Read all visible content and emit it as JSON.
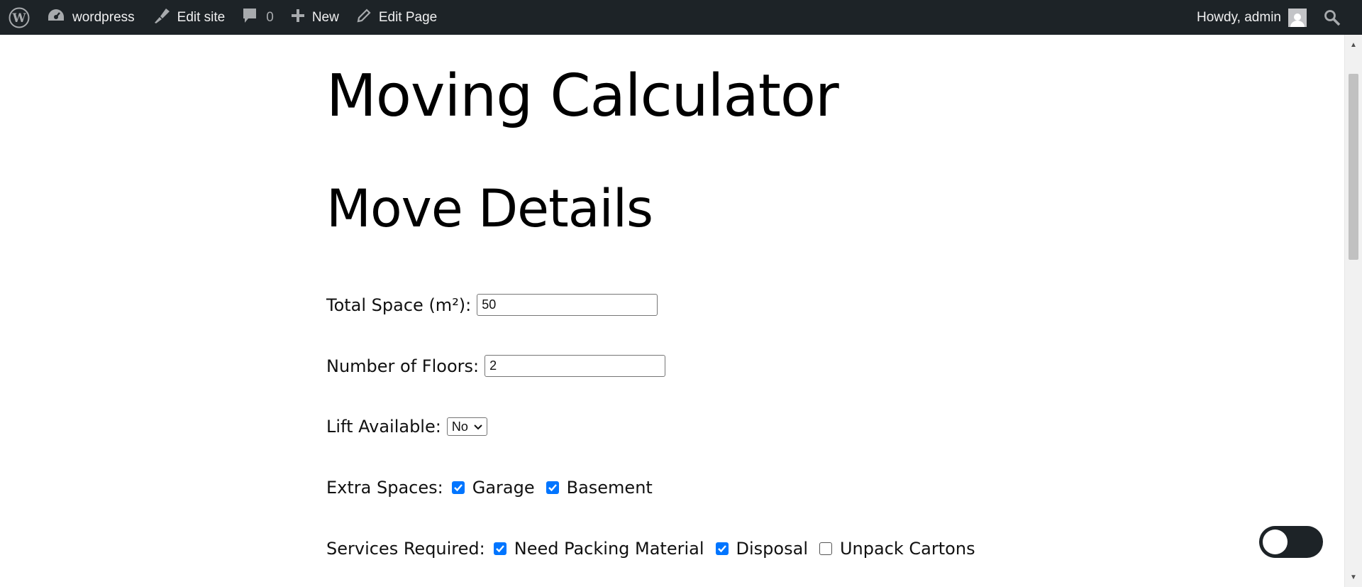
{
  "adminbar": {
    "site_name": "wordpress",
    "edit_site": "Edit site",
    "comments_count": "0",
    "new_label": "New",
    "edit_page": "Edit Page",
    "howdy": "Howdy, admin"
  },
  "page": {
    "title": "Moving Calculator",
    "section_title": "Move Details"
  },
  "form": {
    "total_space": {
      "label": "Total Space (m²):",
      "value": "50"
    },
    "floors": {
      "label": "Number of Floors:",
      "value": "2"
    },
    "lift": {
      "label": "Lift Available:",
      "selected": "No"
    },
    "extra_spaces": {
      "label": "Extra Spaces:",
      "options": [
        {
          "label": "Garage",
          "checked": true
        },
        {
          "label": "Basement",
          "checked": true
        }
      ]
    },
    "services": {
      "label": "Services Required:",
      "options": [
        {
          "label": "Need Packing Material",
          "checked": true
        },
        {
          "label": "Disposal",
          "checked": true
        },
        {
          "label": "Unpack Cartons",
          "checked": false
        }
      ]
    }
  },
  "toggle": {
    "on": false
  },
  "colors": {
    "adminbar_bg": "#1d2327",
    "checkbox_accent": "#0075ff"
  }
}
